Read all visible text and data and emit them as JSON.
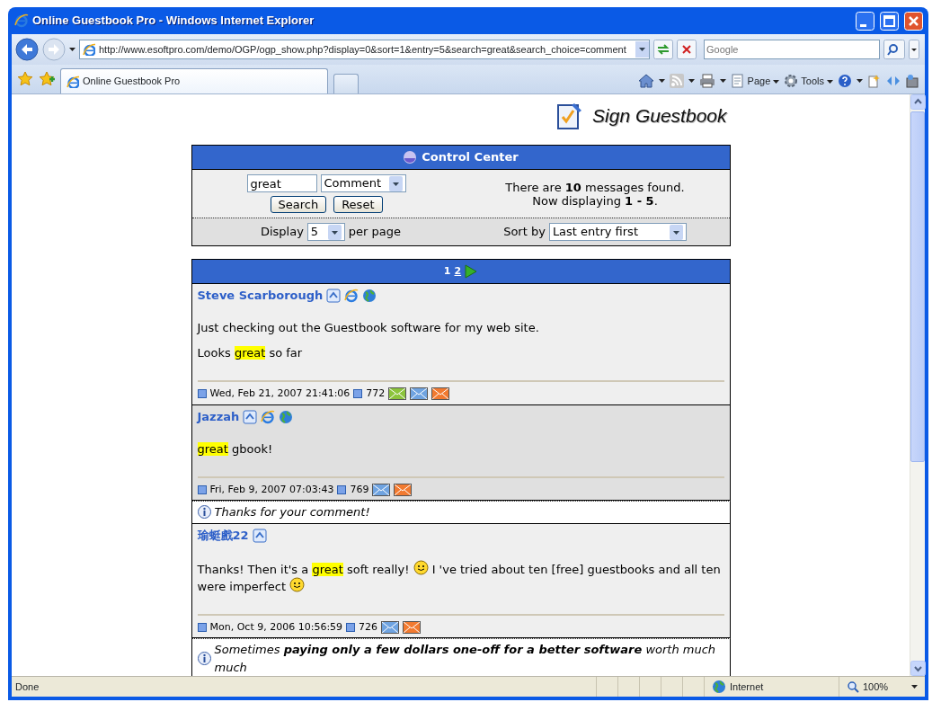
{
  "window": {
    "title": "Online Guestbook Pro - Windows Internet Explorer"
  },
  "address_bar": {
    "url": "http://www.esoftpro.com/demo/OGP/ogp_show.php?display=0&sort=1&entry=5&search=great&search_choice=comment"
  },
  "search": {
    "placeholder": "Google"
  },
  "tabs": [
    {
      "label": "Online Guestbook Pro",
      "selected": true
    }
  ],
  "command_bar": {
    "menus": [
      "Page",
      "Tools"
    ]
  },
  "page": {
    "sign_link": "Sign Guestbook",
    "control_center": {
      "title": "Control Center",
      "search_value": "great",
      "search_choice": "Comment",
      "buttons": [
        "Search",
        "Reset"
      ],
      "summary": [
        "There are **10** messages found.",
        "Now displaying **1 - 5**."
      ],
      "display_label": "Display",
      "display_value": "5",
      "display_suffix": "per page",
      "sort_label": "Sort by",
      "sort_value": "Last entry first"
    },
    "pages": [
      {
        "label": "1",
        "selected": true
      },
      {
        "label": "2",
        "selected": false
      }
    ],
    "messages": [
      {
        "name": "Steve Scarborough",
        "icons": [
          {
            "kind": "quote"
          },
          {
            "kind": "ie"
          },
          {
            "kind": "globe"
          }
        ],
        "paragraphs": [
          [
            {
              "kind": "text",
              "text": "Just checking out the Guestbook software for my web site."
            }
          ],
          [
            {
              "kind": "text",
              "text": "Looks"
            },
            {
              "kind": "highlight",
              "text": "great"
            },
            {
              "kind": "text",
              "text": "so far"
            }
          ]
        ],
        "date": "Wed, Feb 21, 2007 21:41:06",
        "views": "772",
        "mail_icons": [
          {
            "color": "#8cc43c"
          },
          {
            "color": "#6fa3e0"
          },
          {
            "color": "#f27a30"
          }
        ]
      },
      {
        "name": "Jazzah",
        "icons": [
          {
            "kind": "quote"
          },
          {
            "kind": "ie"
          },
          {
            "kind": "globe"
          }
        ],
        "paragraphs": [
          [
            {
              "kind": "highlight",
              "text": "great"
            },
            {
              "kind": "text",
              "text": "gbook!"
            }
          ]
        ],
        "date": "Fri, Feb 9, 2007 07:03:43",
        "views": "769",
        "mail_icons": [
          {
            "color": "#6fa3e0"
          },
          {
            "color": "#f27a30"
          }
        ],
        "reply": "Thanks for your comment!"
      },
      {
        "name": "瑜蜓戲22",
        "icons": [
          {
            "kind": "quote"
          }
        ],
        "paragraphs": [
          [
            {
              "kind": "text",
              "text": "Thanks! Then it's a"
            },
            {
              "kind": "highlight",
              "text": "great"
            },
            {
              "kind": "text",
              "text": "soft really!"
            },
            {
              "kind": "smiley"
            },
            {
              "kind": "text",
              "text": "I 've tried about ten [free] guestbooks and all ten"
            },
            {
              "kind": "text",
              "text": "were imperfect"
            },
            {
              "kind": "smiley"
            }
          ]
        ],
        "date": "Mon, Oct 9, 2006 10:56:59",
        "views": "726",
        "mail_icons": [
          {
            "color": "#6fa3e0"
          },
          {
            "color": "#f27a30"
          }
        ],
        "reply": "Sometimes **paying only a few dollars one-off for a better software** worth much much"
      }
    ]
  },
  "status_bar": {
    "text": "Done",
    "zone": "Internet",
    "zoom": "100%"
  }
}
